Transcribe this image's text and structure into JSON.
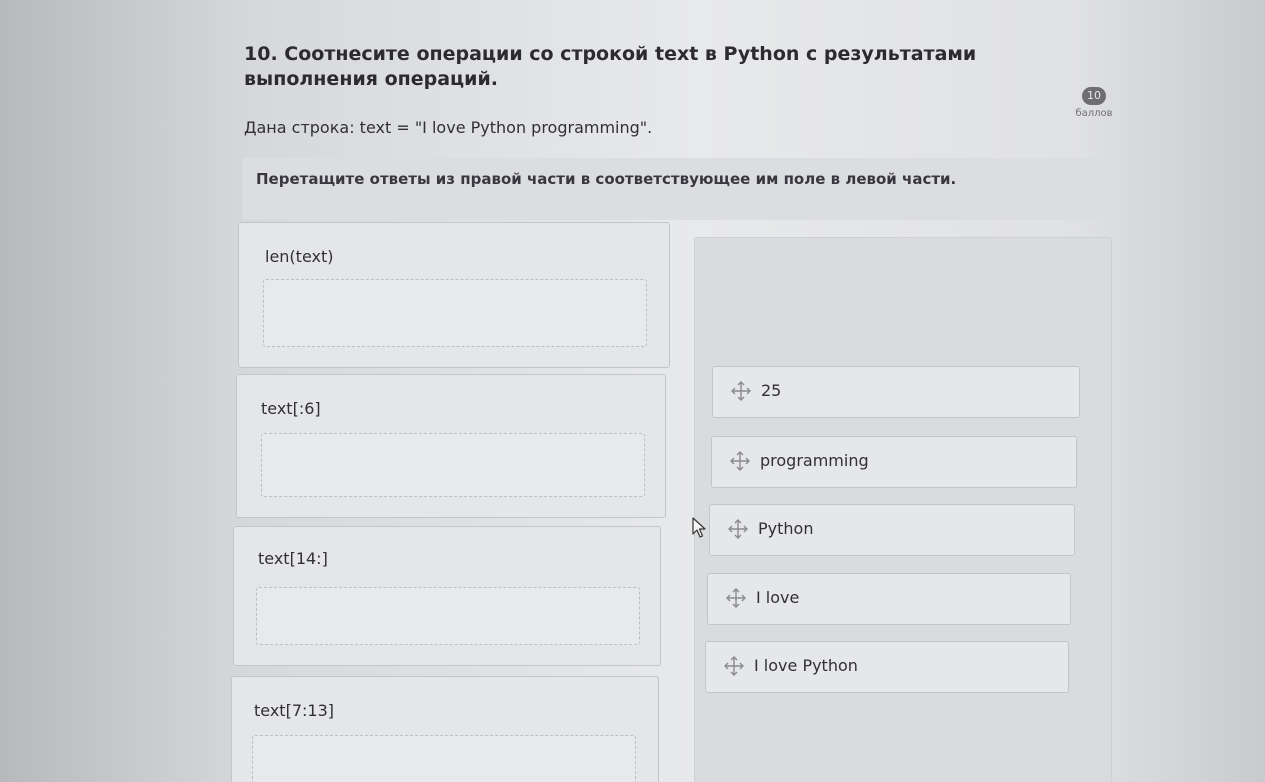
{
  "question": {
    "title": "10. Соотнесите операции со строкой text в Python с результатами выполнения операций.",
    "given": "Дана строка: text = \"I love Python programming\".",
    "score_value": "10",
    "score_label": "баллов",
    "instruction": "Перетащите ответы из правой части в соответствующее им поле в левой части."
  },
  "operations": [
    {
      "label": "len(text)"
    },
    {
      "label": "text[:6]"
    },
    {
      "label": "text[14:]"
    },
    {
      "label": "text[7:13]"
    }
  ],
  "answers": [
    {
      "label": "25",
      "icon": "move-icon"
    },
    {
      "label": "programming",
      "icon": "move-icon"
    },
    {
      "label": "Python",
      "icon": "move-icon"
    },
    {
      "label": "I love",
      "icon": "move-icon"
    },
    {
      "label": "I love Python",
      "icon": "move-icon"
    }
  ],
  "colors": {
    "score_badge": "#6e6e72",
    "card_bg": "#e5e6e8",
    "border": "#c4c5c8",
    "text": "#303036"
  }
}
